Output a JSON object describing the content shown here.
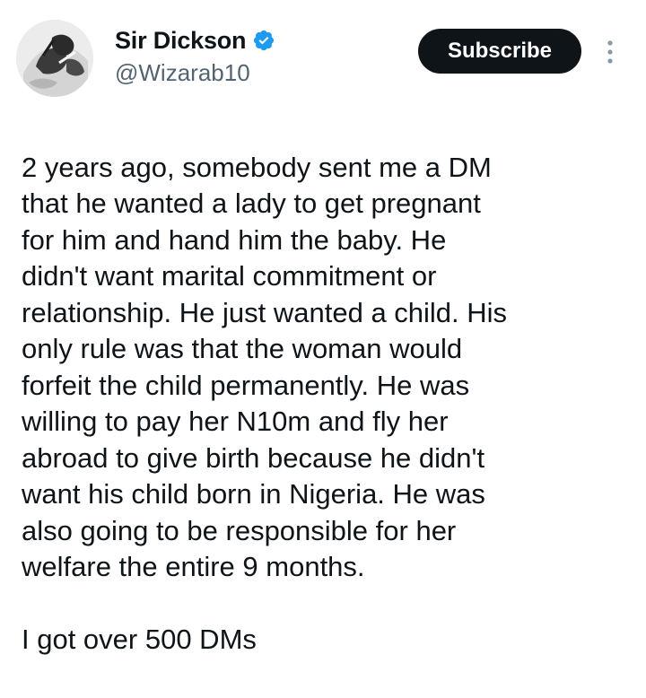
{
  "author": {
    "display_name": "Sir Dickson",
    "handle": "@Wizarab10",
    "verified": true,
    "verified_color": "#1d9bf0",
    "avatar_icon": "profile-photo"
  },
  "actions": {
    "subscribe_label": "Subscribe",
    "more_icon": "more-vertical-icon"
  },
  "tweet": {
    "paragraphs": [
      "2 years ago, somebody sent me a DM\nthat he wanted a lady to get pregnant\nfor him and hand him the baby. He\ndidn't want marital commitment or\nrelationship. He just wanted a child. His\nonly rule was that the woman would\nforfeit the child permanently. He was\nwilling to pay her N10m and fly her\nabroad to give birth because he didn't\nwant his child born in Nigeria. He was\nalso going to be responsible for her\nwelfare the entire 9 months.",
      "I got over 500 DMs"
    ]
  },
  "colors": {
    "text": "#0f1419",
    "secondary_text": "#536471",
    "button_bg": "#0f1419",
    "button_text": "#ffffff"
  }
}
